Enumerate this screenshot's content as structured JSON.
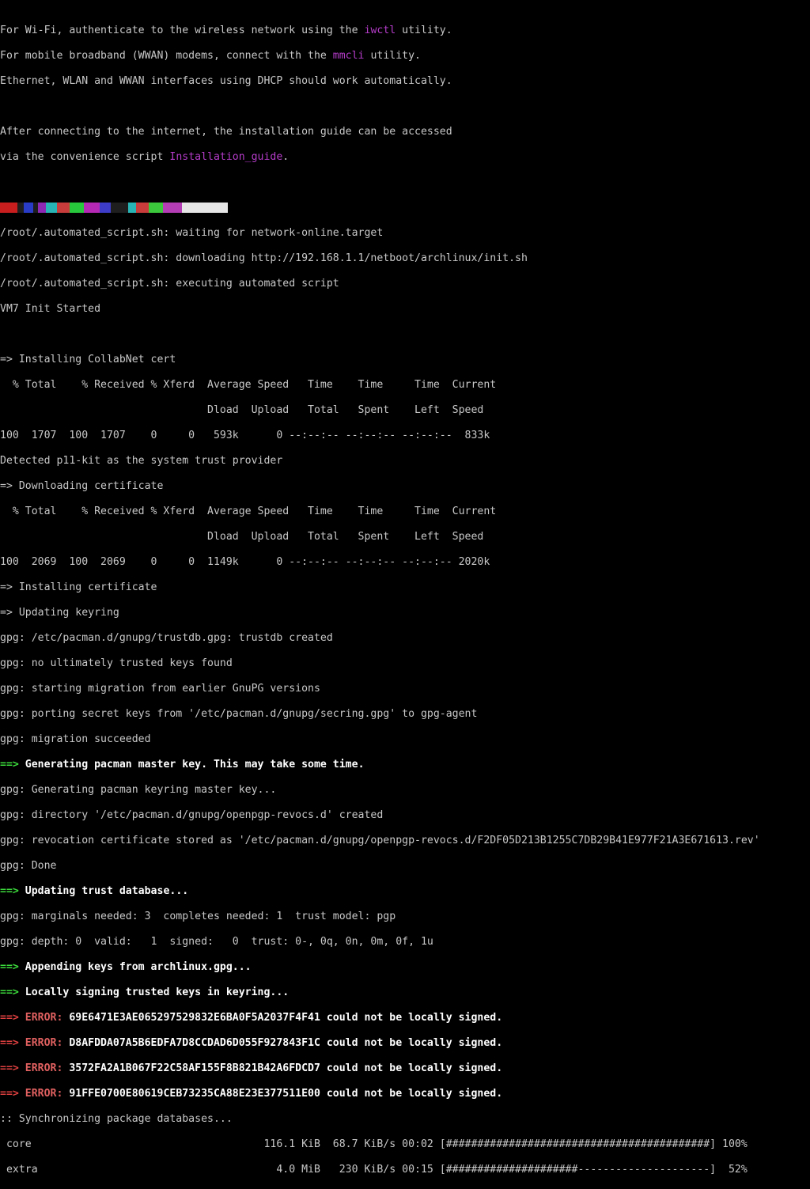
{
  "intro": {
    "wifi": {
      "pre": "For Wi-Fi, authenticate to the wireless network using the ",
      "cmd": "iwctl",
      "post": " utility."
    },
    "wwan": {
      "pre": "For mobile broadband (WWAN) modems, connect with the ",
      "cmd": "mmcli",
      "post": " utility."
    },
    "ethernet": "Ethernet, WLAN and WWAN interfaces using DHCP should work automatically.",
    "guide_line1": "After connecting to the internet, the installation guide can be accessed",
    "guide_line2": {
      "pre": "via the convenience script ",
      "cmd": "Installation_guide",
      "post": "."
    }
  },
  "colors": {
    "background": "#000000",
    "text": "#c8c8c8",
    "highlight": "#b43cc8",
    "green_arrow": "#3cdc3c",
    "error": "#e04040",
    "color_bar": [
      "#c81e1e",
      "#1e1e1e",
      "#283cc8",
      "#1e1e1e",
      "#8c28b4",
      "#28b4b4",
      "#c83c3c",
      "#28c83c",
      "#b428b4",
      "#3c3cc8",
      "#1e1e1e",
      "#28b4b4",
      "#c83c3c",
      "#3cc83c",
      "#b43cb4",
      "#e6e6e6"
    ]
  },
  "script": {
    "waiting": "/root/.automated_script.sh: waiting for network-online.target",
    "downloading": "/root/.automated_script.sh: downloading http://192.168.1.1/netboot/archlinux/init.sh",
    "executing": "/root/.automated_script.sh: executing automated script",
    "vm_init": "VM7 Init Started"
  },
  "cert": {
    "installing_collabnet": "=> Installing CollabNet cert",
    "curl_header1": "  % Total    % Received % Xferd  Average Speed   Time    Time     Time  Current",
    "curl_header2": "                                 Dload  Upload   Total   Spent    Left  Speed",
    "curl_progress1": "100  1707  100  1707    0     0   593k      0 --:--:-- --:--:-- --:--:--  833k",
    "detected_p11": "Detected p11-kit as the system trust provider",
    "downloading_cert": "=> Downloading certificate",
    "curl_header3": "  % Total    % Received % Xferd  Average Speed   Time    Time     Time  Current",
    "curl_header4": "                                 Dload  Upload   Total   Spent    Left  Speed",
    "curl_progress2": "100  2069  100  2069    0     0  1149k      0 --:--:-- --:--:-- --:--:-- 2020k",
    "installing_cert": "=> Installing certificate",
    "updating_keyring": "=> Updating keyring"
  },
  "gpg1": [
    "gpg: /etc/pacman.d/gnupg/trustdb.gpg: trustdb created",
    "gpg: no ultimately trusted keys found",
    "gpg: starting migration from earlier GnuPG versions",
    "gpg: porting secret keys from '/etc/pacman.d/gnupg/secring.gpg' to gpg-agent",
    "gpg: migration succeeded"
  ],
  "pacman": {
    "arrow": "==>",
    "generating_master": " Generating pacman master key. This may take some time.",
    "updating_trust": " Updating trust database...",
    "appending_keys": " Appending keys from archlinux.gpg...",
    "locally_signing": " Locally signing trusted keys in keyring...",
    "error_label": " ERROR:"
  },
  "gpg2": [
    "gpg: Generating pacman keyring master key...",
    "gpg: directory '/etc/pacman.d/gnupg/openpgp-revocs.d' created",
    "gpg: revocation certificate stored as '/etc/pacman.d/gnupg/openpgp-revocs.d/F2DF05D213B1255C7DB29B41E977F21A3E671613.rev'",
    "gpg: Done"
  ],
  "gpg3": [
    "gpg: marginals needed: 3  completes needed: 1  trust model: pgp",
    "gpg: depth: 0  valid:   1  signed:   0  trust: 0-, 0q, 0n, 0m, 0f, 1u"
  ],
  "errors": [
    " 69E6471E3AE065297529832E6BA0F5A2037F4F41 could not be locally signed.",
    " D8AFDDA07A5B6EDFA7D8CCDAD6D055F927843F1C could not be locally signed.",
    " 3572FA2A1B067F22C58AF155F8B821B42A6FDCD7 could not be locally signed.",
    " 91FFE0700E80619CEB73235CA88E23E377511E00 could not be locally signed."
  ],
  "sync": {
    "header": ":: Synchronizing package databases...",
    "core": " core                                     116.1 KiB  68.7 KiB/s 00:02 [##########################################] 100%",
    "extra": " extra                                      4.0 MiB   230 KiB/s 00:15 [#####################---------------------]  52%"
  }
}
